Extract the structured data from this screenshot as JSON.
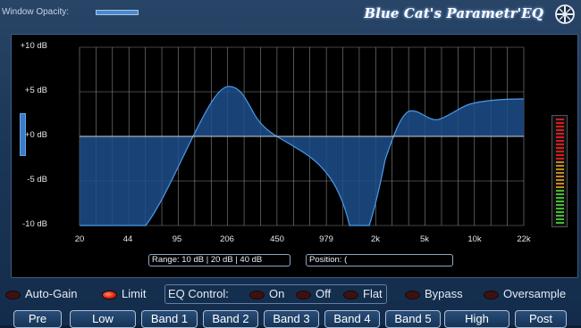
{
  "titlebar": {
    "opacity_label": "Window Opacity:",
    "app_title": "Blue Cat's Parametr'EQ",
    "logo_icon": "blue-cat-logo-icon"
  },
  "graph": {
    "y_labels": [
      "+10 dB",
      "+5 dB",
      "+0 dB",
      "-5 dB",
      "-10 dB"
    ],
    "x_labels": [
      "20",
      "44",
      "95",
      "206",
      "450",
      "979",
      "2k",
      "5k",
      "10k",
      "22k"
    ],
    "colors": {
      "fill": "#1d4f8c",
      "line": "#4a9be8",
      "grid": "#8a8a8a",
      "zero_line": "#d0d0d0"
    }
  },
  "range": {
    "label": "Range:",
    "options": [
      "10 dB",
      "20 dB",
      "40 dB"
    ],
    "text": "Range:  10 dB | 20 dB | 40 dB"
  },
  "position": {
    "text": "Position: ("
  },
  "options": {
    "auto_gain": "Auto-Gain",
    "limit": "Limit",
    "eq_control_label": "EQ Control:",
    "on": "On",
    "off": "Off",
    "flat": "Flat",
    "bypass": "Bypass",
    "oversample": "Oversample"
  },
  "leds": {
    "auto_gain_on": false,
    "limit_on": true,
    "on_on": false,
    "off_on": false,
    "flat_on": false,
    "bypass_on": false,
    "oversample_on": false
  },
  "bands": [
    "Pre",
    "Low",
    "Band 1",
    "Band 2",
    "Band 3",
    "Band 4",
    "Band 5",
    "High",
    "Post"
  ],
  "meter_colors": {
    "top": "#d81b1b",
    "mid": "#c7871a",
    "low": "#3fbf2b"
  }
}
